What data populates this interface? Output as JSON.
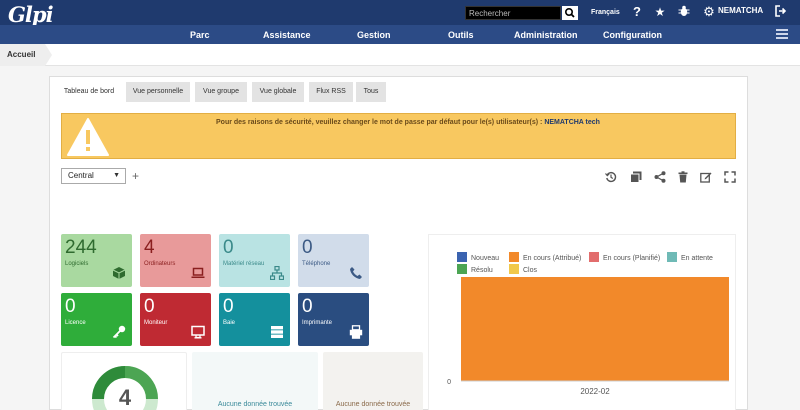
{
  "header": {
    "logo": "Glpi",
    "search_placeholder": "Rechercher",
    "language": "Français",
    "username": "NEMATCHA",
    "icons": [
      "help-icon",
      "star-icon",
      "bug-icon",
      "gear-icon",
      "logout-icon"
    ]
  },
  "menu": {
    "items": [
      "Parc",
      "Assistance",
      "Gestion",
      "Outils",
      "Administration",
      "Configuration"
    ]
  },
  "breadcrumb": "Accueil",
  "tabs": [
    "Tableau de bord",
    "Vue personnelle",
    "Vue groupe",
    "Vue globale",
    "Flux RSS",
    "Tous"
  ],
  "alert": {
    "text": "Pour des raisons de sécurité, veuillez changer le mot de passe par défaut pour le(s) utilisateur(s) : ",
    "users": "NEMATCHA tech"
  },
  "dashboard": {
    "selected": "Central",
    "add": "+",
    "toolbar_icons": [
      "history-icon",
      "copy-icon",
      "share-icon",
      "delete-icon",
      "edit-icon",
      "fullscreen-icon"
    ]
  },
  "cards": [
    {
      "value": "244",
      "label": "Logiciels",
      "bg": "#a9d9a0",
      "fg": "#2f6b2f",
      "icon": "box-icon"
    },
    {
      "value": "4",
      "label": "Ordinateurs",
      "bg": "#e89a9a",
      "fg": "#8a1f1f",
      "icon": "laptop-icon"
    },
    {
      "value": "0",
      "label": "Matériel réseau",
      "bg": "#b9e3e3",
      "fg": "#3a8a8a",
      "icon": "network-icon"
    },
    {
      "value": "0",
      "label": "Téléphone",
      "bg": "#d1dcea",
      "fg": "#3c5a85",
      "icon": "phone-icon"
    },
    {
      "value": "0",
      "label": "Licence",
      "bg": "#2fad3a",
      "fg": "#ffffff",
      "icon": "key-icon"
    },
    {
      "value": "0",
      "label": "Moniteur",
      "bg": "#bf2a33",
      "fg": "#ffffff",
      "icon": "monitor-icon"
    },
    {
      "value": "0",
      "label": "Baie",
      "bg": "#14909d",
      "fg": "#ffffff",
      "icon": "server-icon"
    },
    {
      "value": "0",
      "label": "Imprimante",
      "bg": "#2a4d80",
      "fg": "#ffffff",
      "icon": "printer-icon"
    }
  ],
  "lower": {
    "donut_value": "4",
    "nodata_1": "Aucune donnée trouvée",
    "nodata_2": "Aucune donnée trouvée"
  },
  "chart_data": {
    "type": "bar",
    "title": "",
    "categories": [
      "2022-02"
    ],
    "series": [
      {
        "name": "Nouveau",
        "color": "#3b63b0",
        "values": [
          0
        ]
      },
      {
        "name": "En cours (Attribué)",
        "color": "#f2892a",
        "values": [
          1
        ]
      },
      {
        "name": "En cours (Planifié)",
        "color": "#e26d6d",
        "values": [
          0
        ]
      },
      {
        "name": "En attente",
        "color": "#6fbab6",
        "values": [
          0
        ]
      },
      {
        "name": "Résolu",
        "color": "#4ca553",
        "values": [
          0
        ]
      },
      {
        "name": "Clos",
        "color": "#f1c84b",
        "values": [
          0
        ]
      }
    ],
    "y_tick_labels": [
      "0"
    ]
  }
}
